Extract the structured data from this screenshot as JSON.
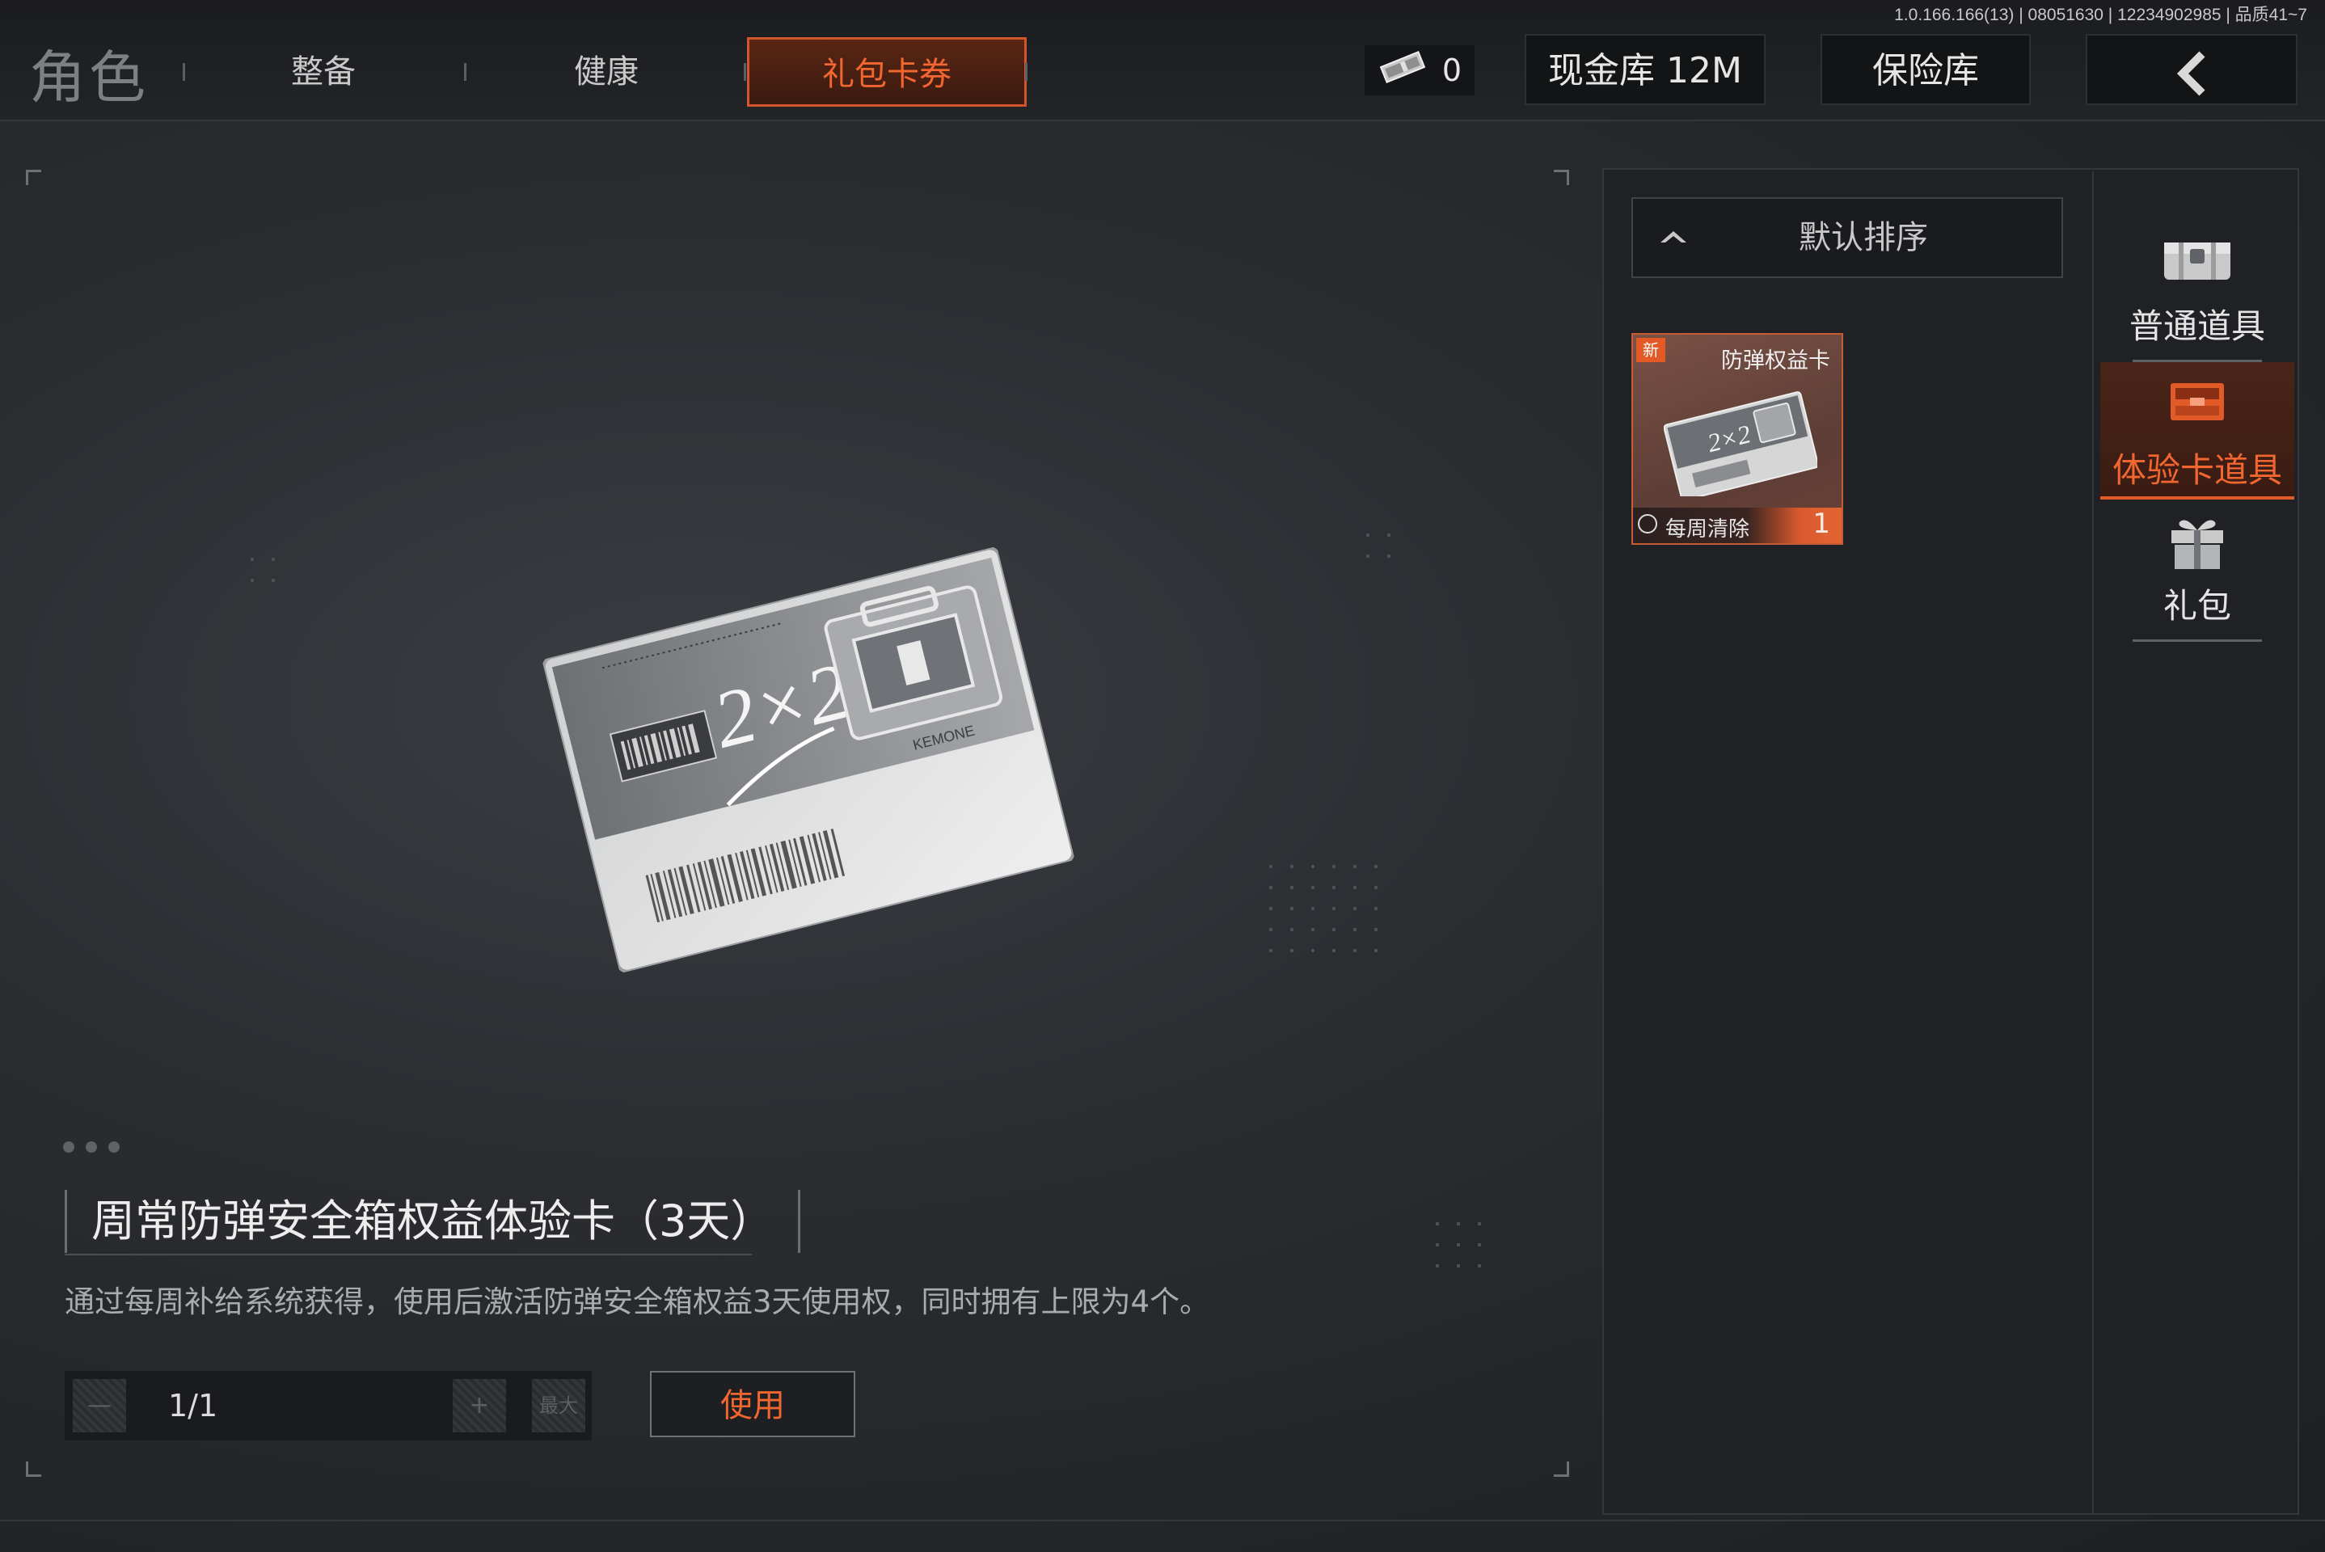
{
  "version_info": "1.0.166.166(13) | 08051630 | 12234902985 | 品质41~7",
  "header": {
    "title": "角色",
    "tabs": [
      {
        "label": "整备",
        "active": false
      },
      {
        "label": "健康",
        "active": false
      },
      {
        "label": "礼包卡券",
        "active": true
      }
    ],
    "currency": {
      "icon": "ticket-icon",
      "value": "0"
    },
    "cash_vault_label": "现金库 12M",
    "safe_box_label": "保险库",
    "back_icon": "chevron-left-icon"
  },
  "detail": {
    "item_image_icon": "safe-box-card-icon",
    "card_text": "2×2",
    "card_brand": "KEMONE",
    "pager": {
      "count": 3,
      "current": 1
    },
    "title": "周常防弹安全箱权益体验卡（3天）",
    "description": "通过每周补给系统获得，使用后激活防弹安全箱权益3天使用权，同时拥有上限为4个。",
    "quantity": {
      "value": "1/1",
      "minus_label": "—",
      "plus_label": "+",
      "max_label": "最大"
    },
    "use_button_label": "使用"
  },
  "inventory": {
    "sort_label": "默认排序",
    "items": [
      {
        "new_badge": "新",
        "name": "防弹权益卡",
        "tag": "每周清除",
        "count": "1",
        "card_text": "2×2"
      }
    ]
  },
  "categories": [
    {
      "label": "普通道具",
      "icon": "chest-icon",
      "active": false
    },
    {
      "label": "体验卡道具",
      "icon": "card-case-icon",
      "active": true
    },
    {
      "label": "礼包",
      "icon": "gift-icon",
      "active": false
    }
  ],
  "colors": {
    "accent": "#f2662f",
    "accent_border": "#d2562a",
    "panel": "#1f2124"
  }
}
